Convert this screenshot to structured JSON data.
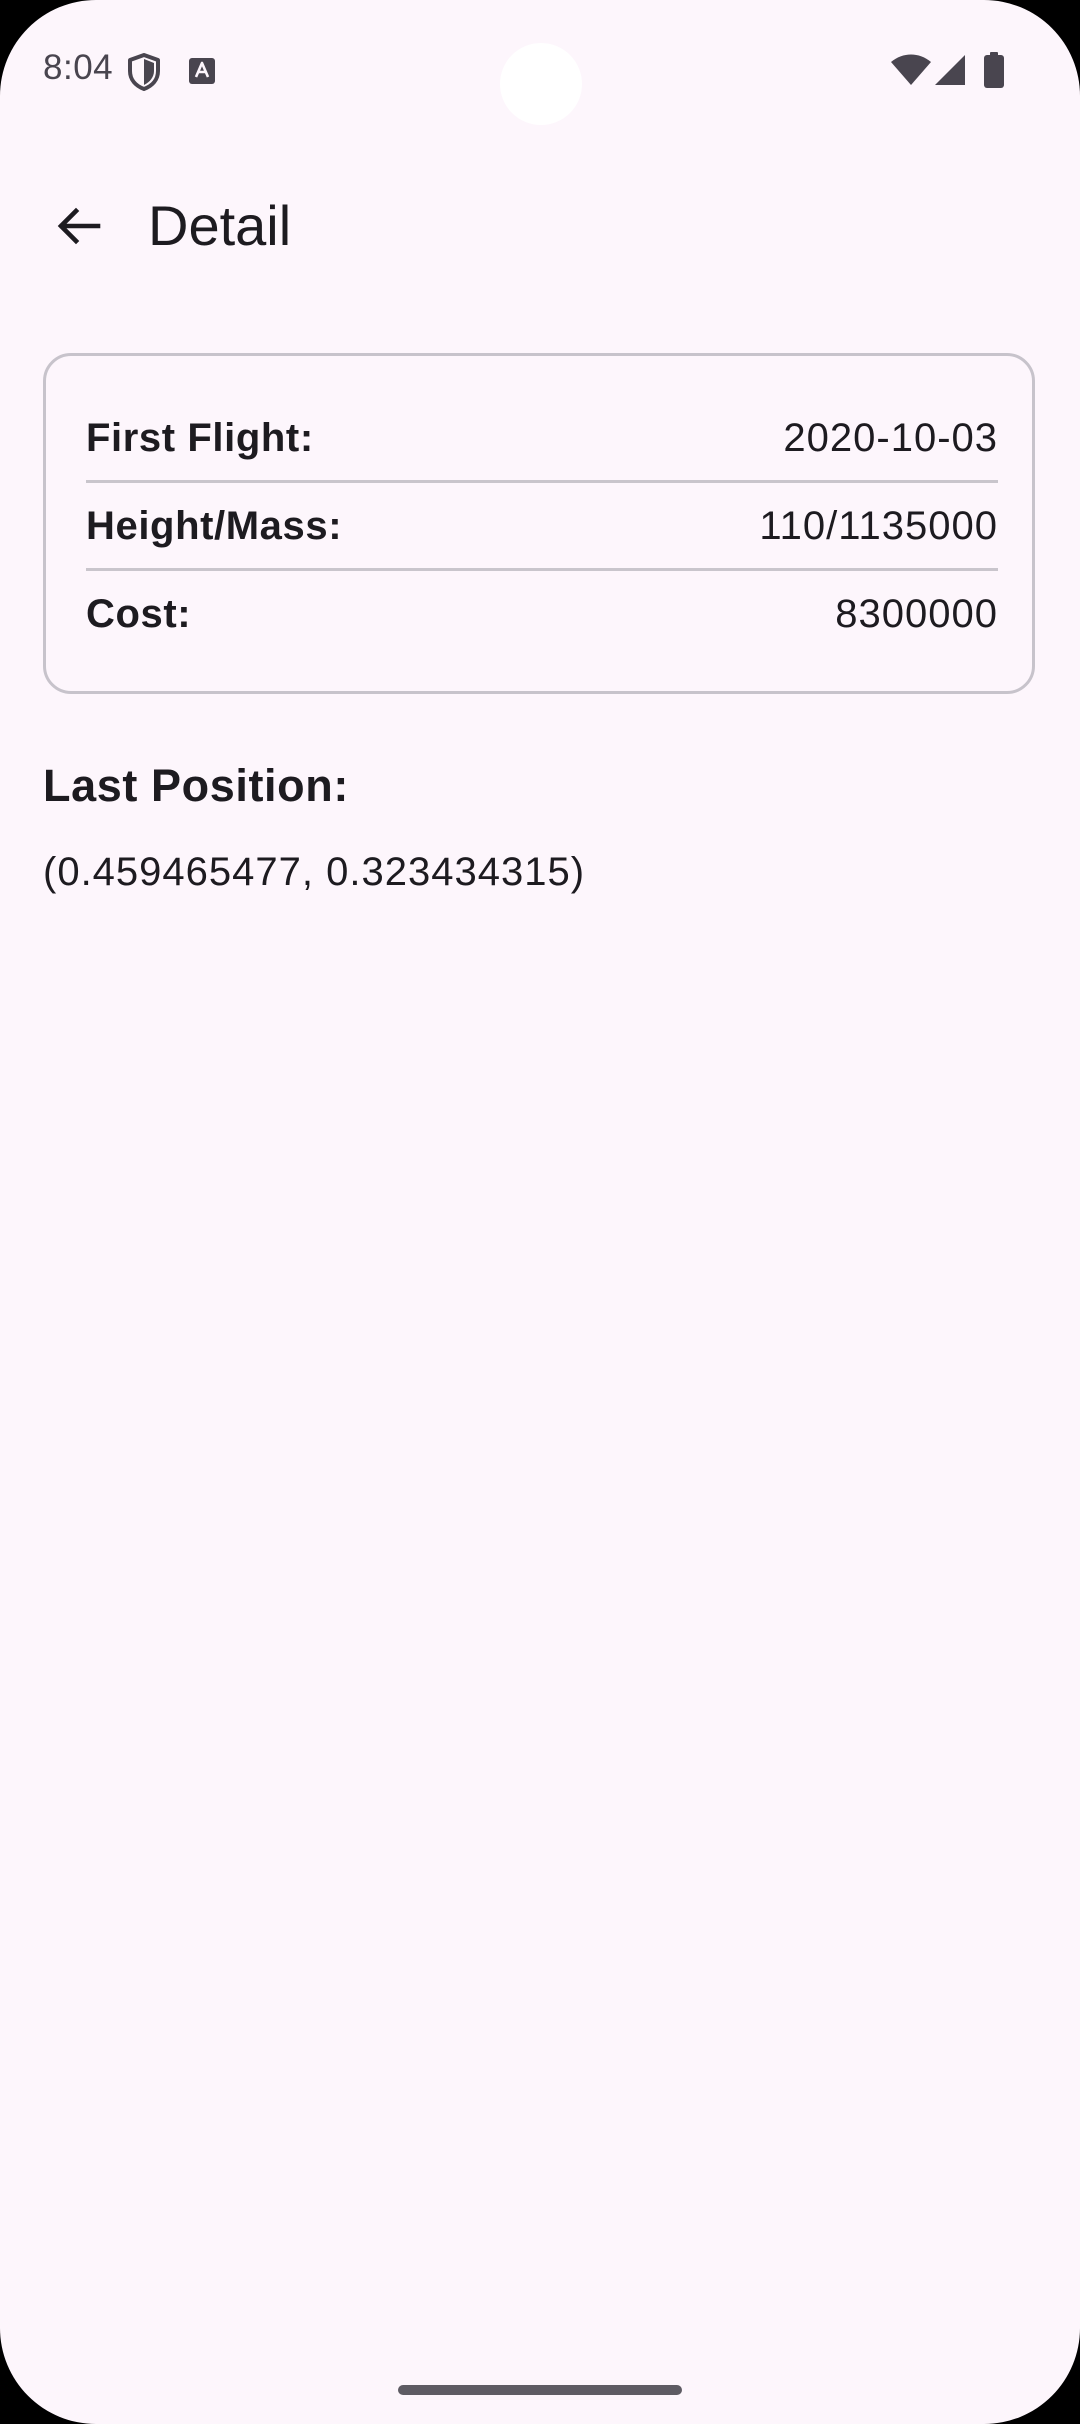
{
  "status_bar": {
    "time": "8:04",
    "icons": [
      "shield-icon",
      "keyboard-a-icon",
      "wifi-icon",
      "cellular-icon",
      "battery-icon"
    ]
  },
  "app_bar": {
    "title": "Detail",
    "back_icon": "arrow-back-icon"
  },
  "details": {
    "rows": [
      {
        "label": "First Flight:",
        "value": "2020-10-03"
      },
      {
        "label": "Height/Mass:",
        "value": "110/1135000"
      },
      {
        "label": "Cost:",
        "value": "8300000"
      }
    ]
  },
  "last_position": {
    "title": "Last Position:",
    "value": "(0.459465477, 0.323434315)"
  },
  "colors": {
    "background": "#fdf6fc",
    "card_border": "#c7c3cb",
    "text": "#1d1b20",
    "status_icons": "#49454f"
  }
}
